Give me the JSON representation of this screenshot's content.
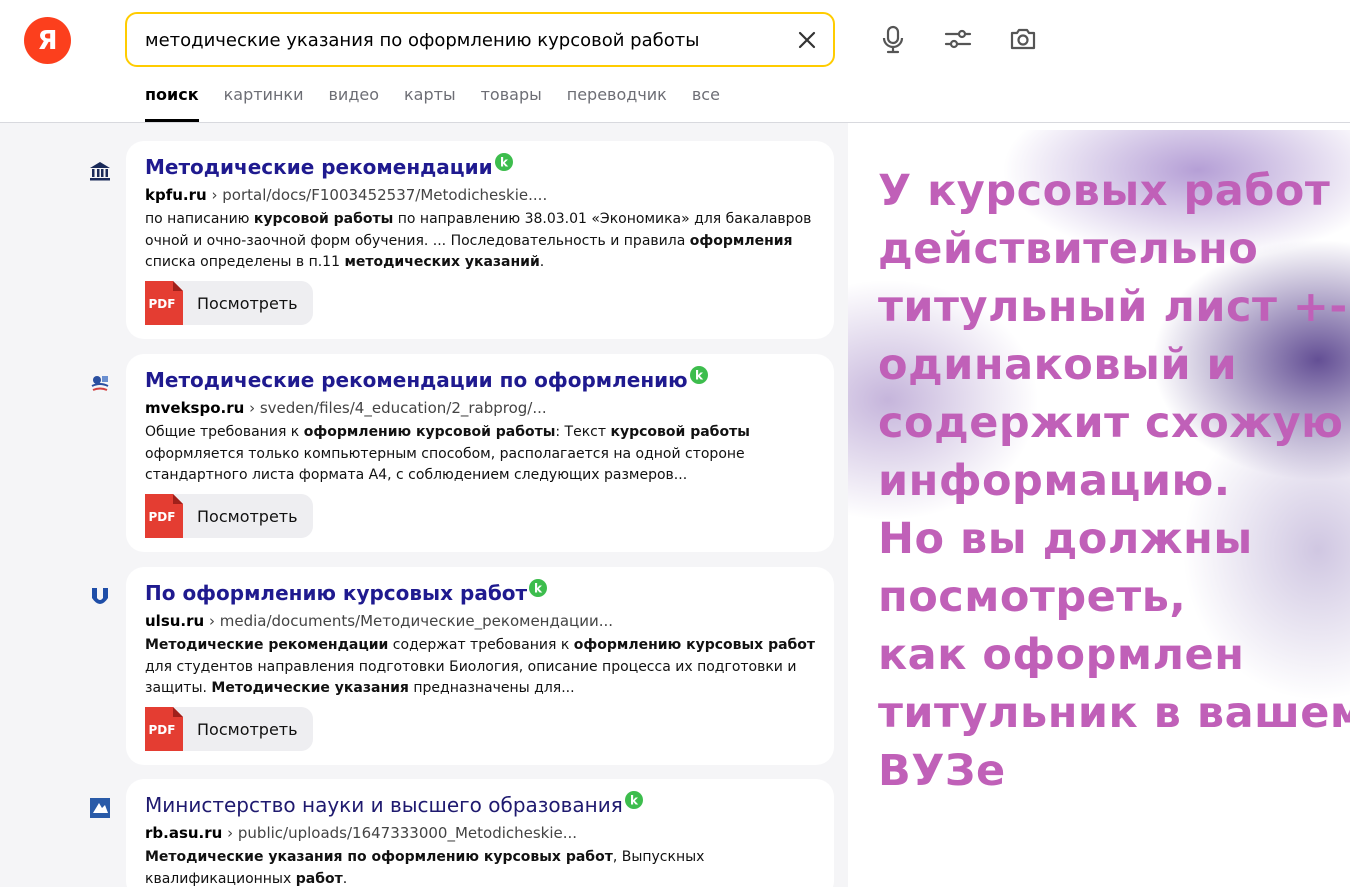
{
  "header": {
    "logo_text": "Я",
    "search": {
      "value": "методические указания по оформлению курсовой работы"
    },
    "icons": [
      "clear-icon",
      "microphone-icon",
      "filters-icon",
      "camera-icon"
    ]
  },
  "tabs": [
    "поиск",
    "картинки",
    "видео",
    "карты",
    "товары",
    "переводчик",
    "все"
  ],
  "results": [
    {
      "title": "Методические рекомендации",
      "domain": "kpfu.ru",
      "path": "portal/docs/F1003452537/Metodicheskie....",
      "snippet_lines": [
        [
          "по написанию ",
          "b:курсовой работы",
          " по направлению 38.03.01 «Экономика» для бакалавров"
        ],
        [
          "очной и очно-заочной форм обучения. ... Последовательность и правила ",
          "b:оформления"
        ],
        [
          "списка определены в п.11 ",
          "b:методических указаний",
          "."
        ]
      ],
      "button": "Посмотреть",
      "pdf_label": "PDF"
    },
    {
      "title": "Методические рекомендации по оформлению",
      "domain": "mvekspo.ru",
      "path": "sveden/files/4_education/2_rabprog/...",
      "snippet_lines": [
        [
          "Общие требования к ",
          "b:оформлению курсовой работы",
          ": Текст ",
          "b:курсовой работы"
        ],
        [
          "оформляется только компьютерным способом, располагается на одной стороне"
        ],
        [
          "стандартного листа формата А4, с соблюдением следующих размеров..."
        ]
      ],
      "button": "Посмотреть",
      "pdf_label": "PDF"
    },
    {
      "title": "По оформлению курсовых работ",
      "domain": "ulsu.ru",
      "path": "media/documents/Методические_рекомендации...",
      "snippet_lines": [
        [
          "b:Методические рекомендации",
          " содержат требования к ",
          "b:оформлению курсовых работ"
        ],
        [
          "для студентов направления подготовки Биология, описание процесса их подготовки и"
        ],
        [
          "защиты. ",
          "b:Методические указания",
          " предназначены для..."
        ]
      ],
      "button": "Посмотреть",
      "pdf_label": "PDF"
    },
    {
      "title": "Министерство науки и высшего образования",
      "domain": "rb.asu.ru",
      "path": "public/uploads/1647333000_Metodicheskie...",
      "snippet_lines": [
        [
          "b:Методические указания по оформлению курсовых работ",
          ", Выпускных"
        ],
        [
          "квалификационных ",
          "b:работ",
          "."
        ]
      ]
    }
  ],
  "overlay": {
    "lines": [
      "У курсовых работ",
      "действительно",
      "титульный лист +-",
      "одинаковый и",
      "содержит схожую",
      "информацию.",
      "Но вы должны",
      "посмотреть,",
      "как оформлен",
      "титульник в вашем",
      "ВУЗе"
    ],
    "color": "#c060b8"
  },
  "colors": {
    "accent": "#fc0",
    "logo": "#fc3f1d",
    "title": "#1f1a8f",
    "badge": "#3dbd4d"
  }
}
